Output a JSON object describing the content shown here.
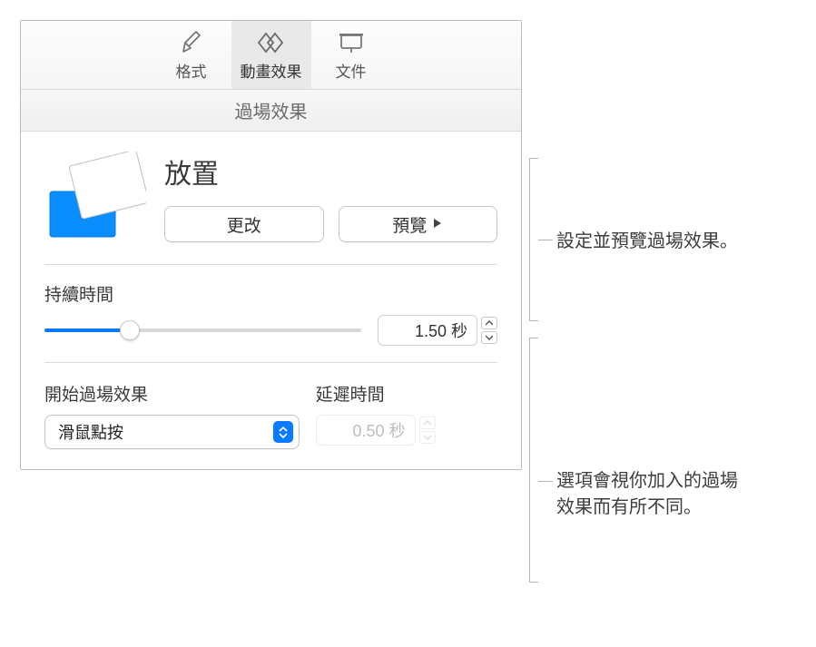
{
  "tabs": {
    "format": "格式",
    "animate": "動畫效果",
    "document": "文件"
  },
  "section_header": "過場效果",
  "transition": {
    "name": "放置",
    "change_btn": "更改",
    "preview_btn": "預覽"
  },
  "duration": {
    "label": "持續時間",
    "value": "1.50 秒"
  },
  "start": {
    "label": "開始過場效果",
    "selected": "滑鼠點按"
  },
  "delay": {
    "label": "延遲時間",
    "value": "0.50 秒"
  },
  "callouts": {
    "c1": "設定並預覽過場效果。",
    "c2a": "選項會視你加入的過場",
    "c2b": "效果而有所不同。"
  }
}
